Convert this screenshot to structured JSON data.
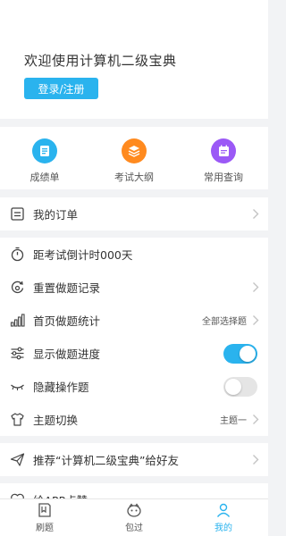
{
  "header": {
    "welcome": "欢迎使用计算机二级宝典",
    "login_label": "登录/注册"
  },
  "shortcuts": [
    {
      "label": "成绩单",
      "color": "#2ab3ee",
      "icon": "document-icon"
    },
    {
      "label": "考试大纲",
      "color": "#ff8a1f",
      "icon": "layers-icon"
    },
    {
      "label": "常用查询",
      "color": "#9b59f6",
      "icon": "calendar-note-icon"
    }
  ],
  "menu": {
    "orders": "我的订单",
    "countdown": "距考试倒计时000天",
    "reset": "重置做题记录",
    "stats": "首页做题统计",
    "stats_value": "全部选择题",
    "progress": "显示做题进度",
    "progress_on": true,
    "hide_ops": "隐藏操作题",
    "hide_ops_on": false,
    "theme": "主题切换",
    "theme_value": "主题一",
    "recommend": "推荐“计算机二级宝典”给好友",
    "like": "给APP点赞"
  },
  "tabbar": {
    "items": [
      {
        "label": "刷题",
        "icon": "book-icon",
        "active": false
      },
      {
        "label": "包过",
        "icon": "mascot-icon",
        "active": false
      },
      {
        "label": "我的",
        "icon": "person-icon",
        "active": true
      }
    ],
    "accent": "#2ab3ee"
  }
}
